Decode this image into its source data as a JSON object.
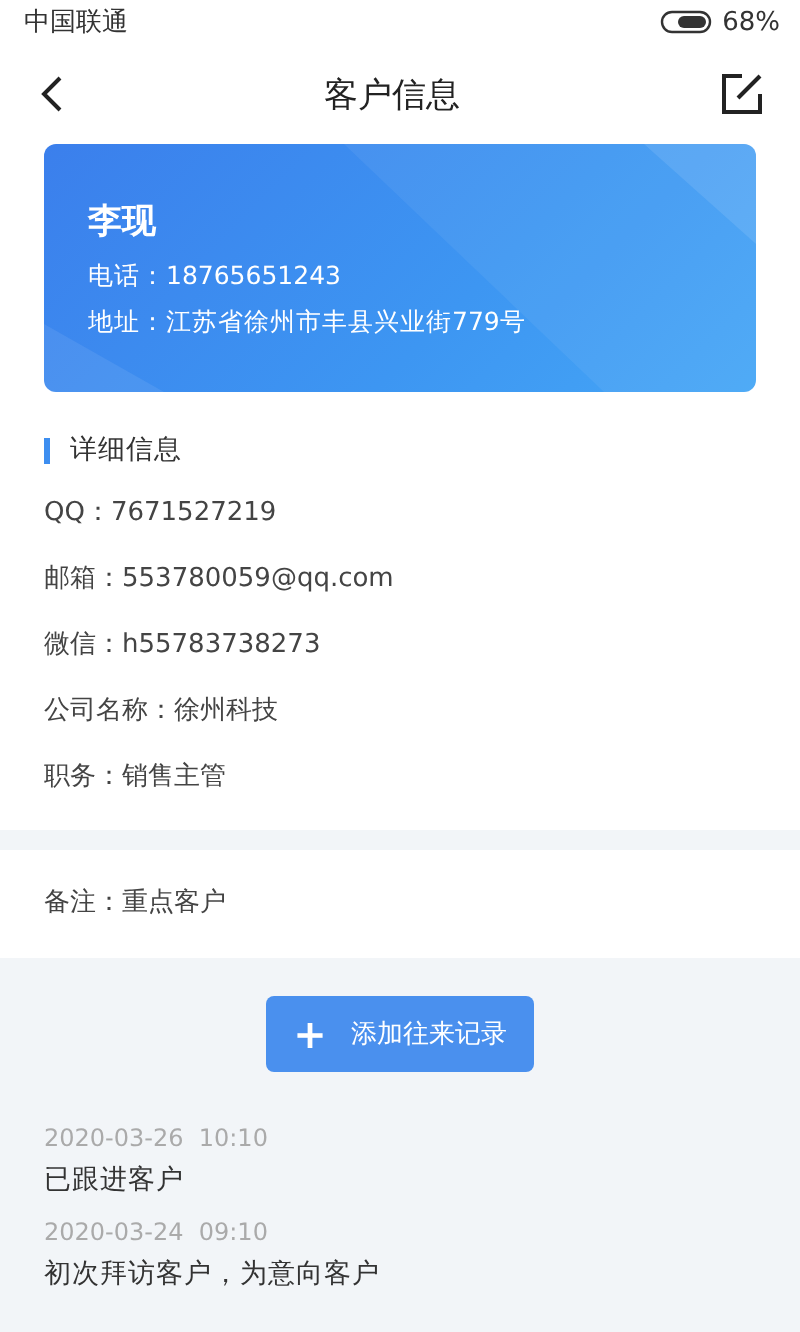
{
  "status_bar": {
    "carrier": "中国联通",
    "battery": "68%"
  },
  "header": {
    "title": "客户信息"
  },
  "customer_card": {
    "name": "李现",
    "phone": "电话：18765651243",
    "address": "地址：江苏省徐州市丰县兴业街779号"
  },
  "details": {
    "title": "详细信息",
    "rows": [
      "QQ：7671527219",
      "邮箱：553780059@qq.com",
      "微信：h55783738273",
      "公司名称：徐州科技",
      "职务：销售主管"
    ]
  },
  "remark": "备注：重点客户",
  "add_button": {
    "icon": "+",
    "label": "添加往来记录"
  },
  "records": [
    {
      "time": "2020-03-26  10:10",
      "text": "已跟进客户"
    },
    {
      "time": "2020-03-24  09:10",
      "text": "初次拜访客户，为意向客户"
    }
  ]
}
